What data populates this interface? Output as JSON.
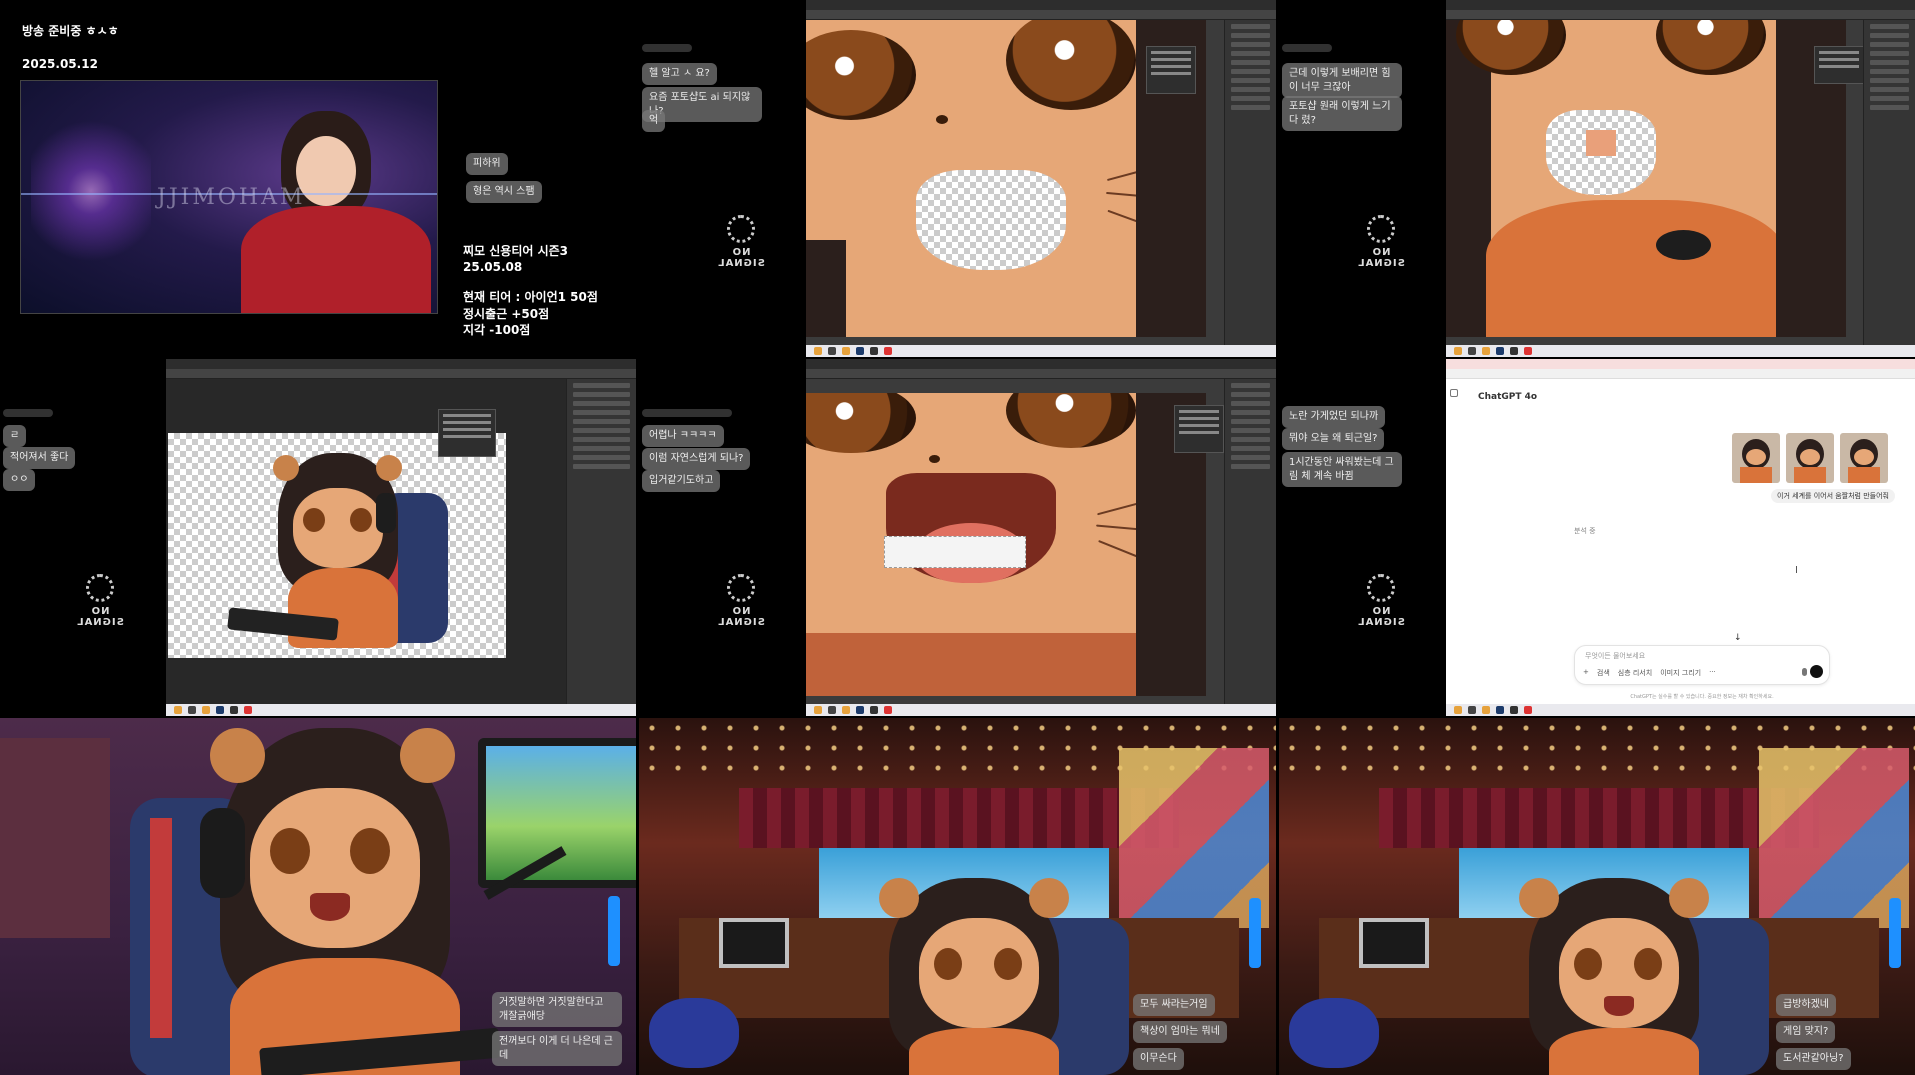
{
  "header": {
    "status": "방송 준비중 ㅎㅅㅎ",
    "date": "2025.05.12"
  },
  "stream_info": {
    "photo_watermark": "JJIMOHAM",
    "title": "찌모 신용티어 시즌3",
    "season_date": "25.05.08",
    "tier": "현재 티어 : 아이언1 50점",
    "on_time": "정시출근 +50점",
    "late": "지각 -100점"
  },
  "chats": {
    "c1": [
      "피하위",
      "형은 역시 스팸"
    ],
    "c2": [
      "헬 알고 ㅅ 요?",
      "요즘 포토샵도 ai 되지않나?",
      "억"
    ],
    "c3": [
      "근데 이렇게 보배리면 힘이 너무 크잖아",
      "포토샵 원래 이렇게 느기다 렸?"
    ],
    "c4": [
      "ㄹ",
      "적어져서 좋다",
      "ㅇㅇ"
    ],
    "c5": [
      "어렵나 ㅋㅋㅋㅋ",
      "이럼 자연스럽게 되나?",
      "입거같기도하고"
    ],
    "c6": [
      "노란 가게었던 되나까",
      "뭐야 오늘 왜 퇴근일?",
      "1시간동안 싸워봤는데 그림 체 계속 바뀜"
    ],
    "c7": [
      "거짓말하면 거짓말한다고 개잘긁애당",
      "전꺼보다 이게 더 나은데 근데"
    ],
    "c8": [
      "모두 싸라는거임",
      "책상이 엄마는 뭐네",
      "이무슨다"
    ],
    "c9": [
      "급방하겠네",
      "게임 맞지?",
      "도서관같아닝?"
    ]
  },
  "no_signal_label": "NO SIGNAL",
  "chatgpt": {
    "model": "ChatGPT 4o",
    "user_message": "이거 세계를 이어서 움짤처럼 만들어줘",
    "status": "분석 중",
    "input_placeholder": "무엇이든 물어보세요",
    "tools": [
      "+",
      "검색",
      "심층 리서치",
      "이미지 그리기",
      "···"
    ],
    "footer": "ChatGPT는 실수를 할 수 있습니다. 중요한 정보는 재차 확인하세요."
  },
  "colors": {
    "bubble": "#787878",
    "skin": "#e6a777",
    "sweater": "#d9733a",
    "hair": "#2b1f1c",
    "photoshop_bg": "#3b3b3b",
    "room_warm": "#6b2a1e"
  }
}
